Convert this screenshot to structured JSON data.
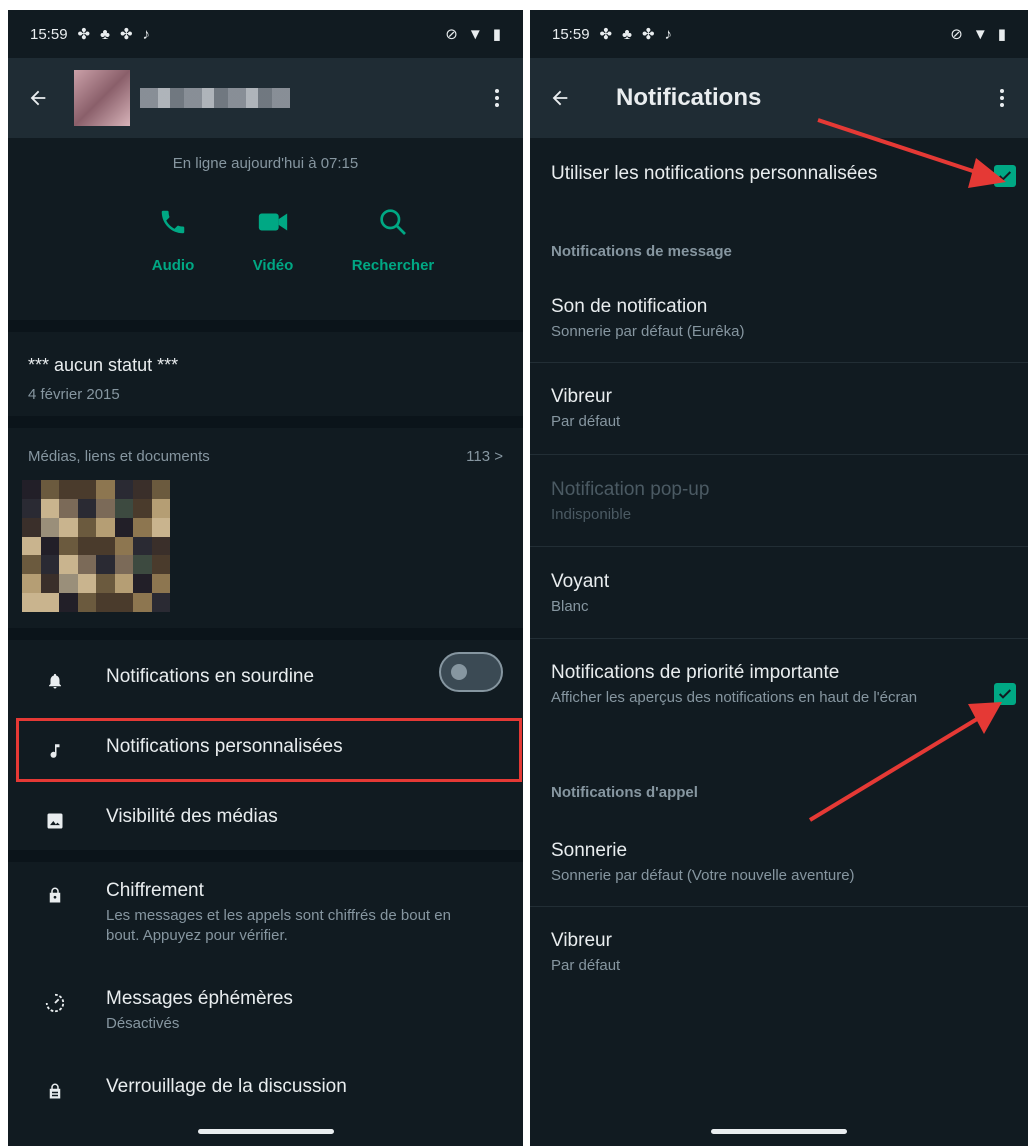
{
  "left": {
    "status_bar": {
      "time": "15:59"
    },
    "online": "En ligne aujourd'hui à 07:15",
    "actions": [
      {
        "label": "Audio",
        "icon": "phone-icon"
      },
      {
        "label": "Vidéo",
        "icon": "video-icon"
      },
      {
        "label": "Rechercher",
        "icon": "search-icon"
      }
    ],
    "status": {
      "text": "*** aucun statut ***",
      "date": "4 février 2015"
    },
    "media": {
      "label": "Médias, liens et documents",
      "count": "113 >"
    },
    "rows": {
      "mute": {
        "title": "Notifications en sourdine",
        "icon": "bell-icon"
      },
      "custom": {
        "title": "Notifications personnalisées",
        "icon": "music-note-icon"
      },
      "visibility": {
        "title": "Visibilité des médias",
        "icon": "image-icon"
      },
      "encryption": {
        "title": "Chiffrement",
        "sub": "Les messages et les appels sont chiffrés de bout en bout. Appuyez pour vérifier.",
        "icon": "lock-icon"
      },
      "ephemeral": {
        "title": "Messages éphémères",
        "sub": "Désactivés",
        "icon": "timer-icon"
      },
      "chatlock": {
        "title": "Verrouillage de la discussion",
        "icon": "chat-lock-icon"
      }
    }
  },
  "right": {
    "status_bar": {
      "time": "15:59"
    },
    "title": "Notifications",
    "use_custom": "Utiliser les notifications personnalisées",
    "section_message": "Notifications de message",
    "items": {
      "sound": {
        "title": "Son de notification",
        "sub": "Sonnerie par défaut (Eurêka)"
      },
      "vibrate": {
        "title": "Vibreur",
        "sub": "Par défaut"
      },
      "popup": {
        "title": "Notification pop-up",
        "sub": "Indisponible"
      },
      "light": {
        "title": "Voyant",
        "sub": "Blanc"
      },
      "priority": {
        "title": "Notifications de priorité importante",
        "sub": "Afficher les aperçus des notifications en haut de l'écran"
      },
      "ringtone": {
        "title": "Sonnerie",
        "sub": "Sonnerie par défaut (Votre nouvelle aventure)"
      },
      "call_vibrate": {
        "title": "Vibreur",
        "sub": "Par défaut"
      }
    },
    "section_call": "Notifications d'appel"
  },
  "colors": {
    "accent": "#00a884",
    "bg": "#111b21",
    "header": "#1f2c34",
    "highlight": "#e53935"
  }
}
